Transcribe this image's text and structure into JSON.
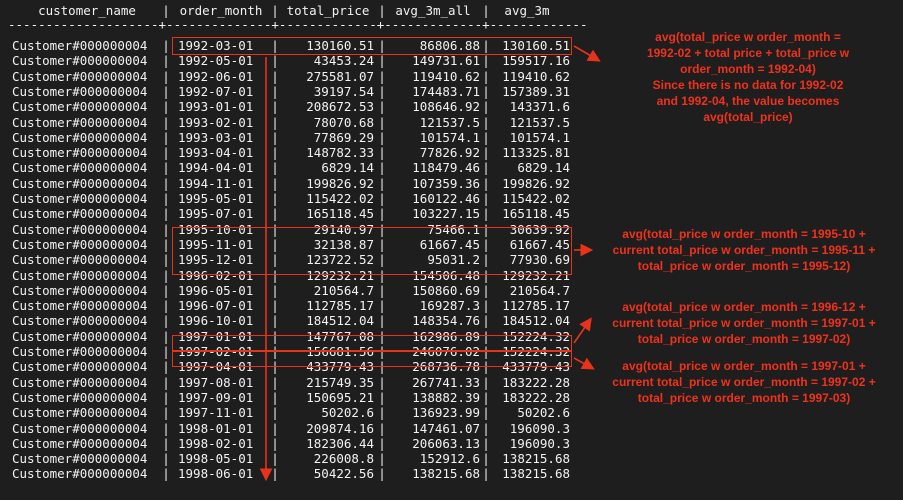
{
  "columns": [
    "customer_name",
    "order_month",
    "total_price",
    "avg_3m_all",
    "avg_3m"
  ],
  "divider": "--------------------+--------------+-------------+-------------+-------------",
  "rows": [
    [
      "Customer#000000004",
      "1992-03-01",
      "130160.51",
      "86806.88",
      "130160.51"
    ],
    [
      "Customer#000000004",
      "1992-05-01",
      "43453.24",
      "149731.61",
      "159517.16"
    ],
    [
      "Customer#000000004",
      "1992-06-01",
      "275581.07",
      "119410.62",
      "119410.62"
    ],
    [
      "Customer#000000004",
      "1992-07-01",
      "39197.54",
      "174483.71",
      "157389.31"
    ],
    [
      "Customer#000000004",
      "1993-01-01",
      "208672.53",
      "108646.92",
      "143371.6"
    ],
    [
      "Customer#000000004",
      "1993-02-01",
      "78070.68",
      "121537.5",
      "121537.5"
    ],
    [
      "Customer#000000004",
      "1993-03-01",
      "77869.29",
      "101574.1",
      "101574.1"
    ],
    [
      "Customer#000000004",
      "1993-04-01",
      "148782.33",
      "77826.92",
      "113325.81"
    ],
    [
      "Customer#000000004",
      "1994-04-01",
      "6829.14",
      "118479.46",
      "6829.14"
    ],
    [
      "Customer#000000004",
      "1994-11-01",
      "199826.92",
      "107359.36",
      "199826.92"
    ],
    [
      "Customer#000000004",
      "1995-05-01",
      "115422.02",
      "160122.46",
      "115422.02"
    ],
    [
      "Customer#000000004",
      "1995-07-01",
      "165118.45",
      "103227.15",
      "165118.45"
    ],
    [
      "Customer#000000004",
      "1995-10-01",
      "29140.97",
      "75466.1",
      "30639.92"
    ],
    [
      "Customer#000000004",
      "1995-11-01",
      "32138.87",
      "61667.45",
      "61667.45"
    ],
    [
      "Customer#000000004",
      "1995-12-01",
      "123722.52",
      "95031.2",
      "77930.69"
    ],
    [
      "Customer#000000004",
      "1996-02-01",
      "129232.21",
      "154506.48",
      "129232.21"
    ],
    [
      "Customer#000000004",
      "1996-05-01",
      "210564.7",
      "150860.69",
      "210564.7"
    ],
    [
      "Customer#000000004",
      "1996-07-01",
      "112785.17",
      "169287.3",
      "112785.17"
    ],
    [
      "Customer#000000004",
      "1996-10-01",
      "184512.04",
      "148354.76",
      "184512.04"
    ],
    [
      "Customer#000000004",
      "1997-01-01",
      "147767.08",
      "162986.89",
      "152224.32"
    ],
    [
      "Customer#000000004",
      "1997-02-01",
      "156681.56",
      "246076.02",
      "152224.32"
    ],
    [
      "Customer#000000004",
      "1997-04-01",
      "433779.43",
      "268736.78",
      "433779.43"
    ],
    [
      "Customer#000000004",
      "1997-08-01",
      "215749.35",
      "267741.33",
      "183222.28"
    ],
    [
      "Customer#000000004",
      "1997-09-01",
      "150695.21",
      "138882.39",
      "183222.28"
    ],
    [
      "Customer#000000004",
      "1997-11-01",
      "50202.6",
      "136923.99",
      "50202.6"
    ],
    [
      "Customer#000000004",
      "1998-01-01",
      "209874.16",
      "147461.07",
      "196090.3"
    ],
    [
      "Customer#000000004",
      "1998-02-01",
      "182306.44",
      "206063.13",
      "196090.3"
    ],
    [
      "Customer#000000004",
      "1998-05-01",
      "226008.8",
      "152912.6",
      "138215.68"
    ],
    [
      "Customer#000000004",
      "1998-06-01",
      "50422.56",
      "138215.68",
      "138215.68"
    ]
  ],
  "annotations": {
    "note1": [
      "avg(total_price w order_month =",
      "1992-02 + total price + total_price w",
      "order_month = 1992-04)",
      "Since there is no data for 1992-02",
      "and 1992-04, the value becomes",
      "avg(total_price)"
    ],
    "note2": [
      "avg(total_price w order_month = 1995-10 +",
      "current total_price w order_month = 1995-11 +",
      "total_price w order_month = 1995-12)"
    ],
    "note3": [
      "avg(total_price w order_month = 1996-12 +",
      "current total_price w order_month = 1997-01 +",
      "total_price w order_month = 1997-02)"
    ],
    "note4": [
      "avg(total_price w order_month = 1997-01 +",
      "current total_price w order_month = 1997-02 +",
      "total_price w order_month = 1997-03)"
    ]
  },
  "colors": {
    "background": "#1e1e1e",
    "text": "#f2f2f2",
    "annotation": "#f0321c"
  }
}
